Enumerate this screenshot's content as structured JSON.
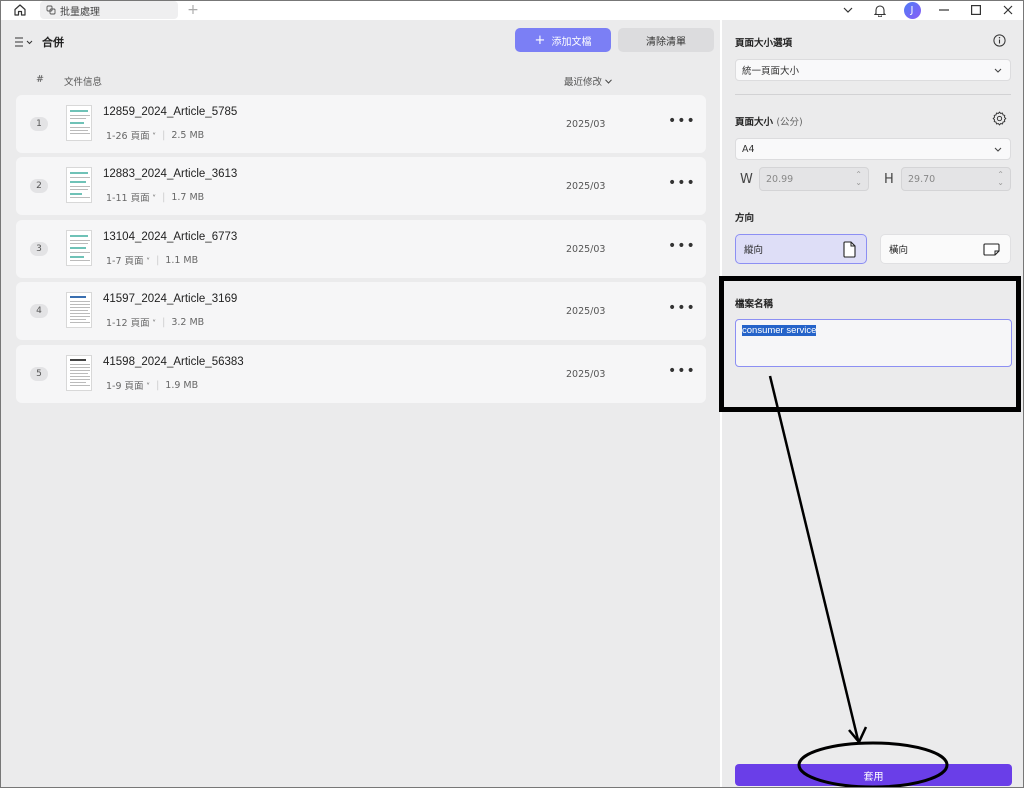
{
  "titlebar": {
    "tab_label": "批量處理",
    "tab_add": "+",
    "avatar_letter": "J"
  },
  "left": {
    "menu_title": "合併",
    "add_button": "添加文檔",
    "add_plus": "+",
    "clear_button": "清除清單",
    "col_num": "#",
    "col_info": "文件信息",
    "col_modified": "最近修改",
    "files": [
      {
        "num": "1",
        "name": "12859_2024_Article_5785",
        "pages": "1-26 頁面",
        "size": "2.5 MB",
        "date": "2025/03",
        "more": "•••"
      },
      {
        "num": "2",
        "name": "12883_2024_Article_3613",
        "pages": "1-11 頁面",
        "size": "1.7 MB",
        "date": "2025/03",
        "more": "•••"
      },
      {
        "num": "3",
        "name": "13104_2024_Article_6773",
        "pages": "1-7 頁面",
        "size": "1.1 MB",
        "date": "2025/03",
        "more": "•••"
      },
      {
        "num": "4",
        "name": "41597_2024_Article_3169",
        "pages": "1-12 頁面",
        "size": "3.2 MB",
        "date": "2025/03",
        "more": "•••"
      },
      {
        "num": "5",
        "name": "41598_2024_Article_56383",
        "pages": "1-9 頁面",
        "size": "1.9 MB",
        "date": "2025/03",
        "more": "•••"
      }
    ]
  },
  "right": {
    "page_size_options_label": "頁面大小選項",
    "page_size_options_value": "統一頁面大小",
    "page_size_label": "頁面大小",
    "page_size_unit": "(公分)",
    "paper_value": "A4",
    "w_label": "W",
    "w_value": "20.99",
    "h_label": "H",
    "h_value": "29.70",
    "orientation_label": "方向",
    "portrait_label": "縱向",
    "landscape_label": "橫向",
    "filename_label": "檔案名稱",
    "filename_value": "consumer service",
    "apply_button": "套用"
  },
  "colors": {
    "accent": "#7b7ff5",
    "apply": "#6a3ee8",
    "panel_bg": "#ebebec",
    "selection": "#2563c9"
  }
}
